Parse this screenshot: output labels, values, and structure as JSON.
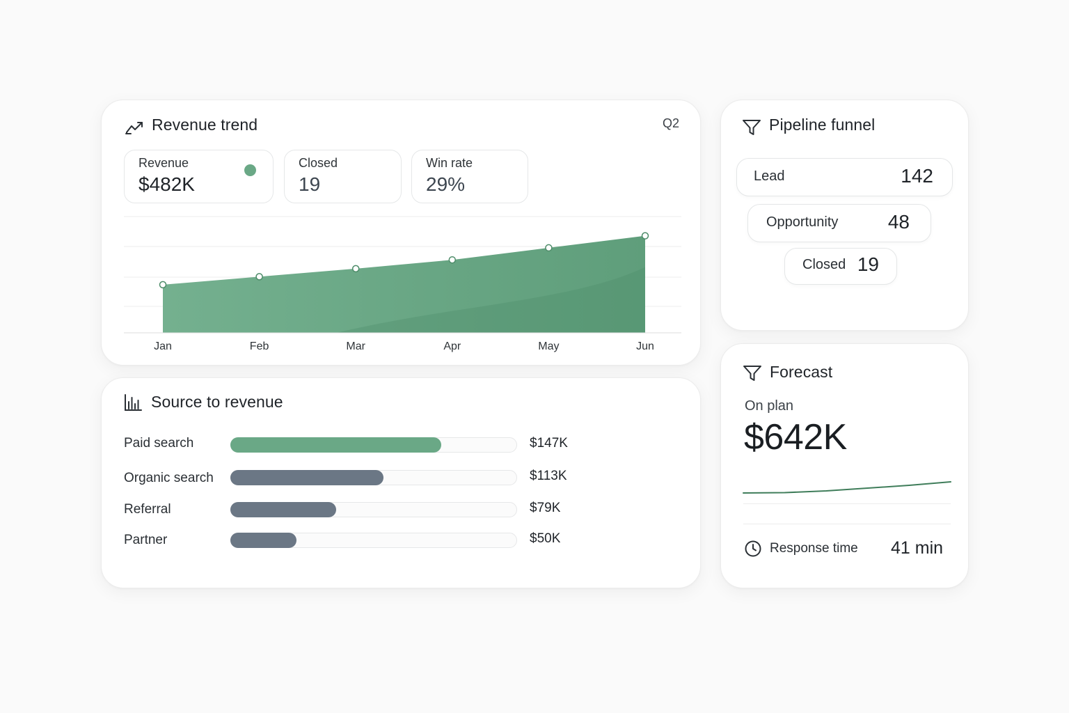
{
  "colors": {
    "accent_green": "#6aa886",
    "green_dark": "#4d8c69",
    "slate_bar": "#6b7785",
    "line_dark": "#3f7d5a"
  },
  "revenue_trend": {
    "title": "Revenue trend",
    "icon": "trend-line-icon",
    "period": "Q2",
    "kpis": [
      {
        "label": "Revenue",
        "value": "$482K"
      },
      {
        "label": "Closed",
        "value": "19"
      },
      {
        "label": "Win rate",
        "value": "29%"
      }
    ]
  },
  "chart_data": {
    "type": "area",
    "title": "",
    "xlabel": "",
    "ylabel": "",
    "categories": [
      "Jan",
      "Feb",
      "Mar",
      "Apr",
      "May",
      "Jun"
    ],
    "series": [
      {
        "values": [
          60,
          70,
          80,
          91,
          106,
          121
        ]
      }
    ],
    "ylim": [
      0,
      145
    ],
    "grid": true,
    "legend": "none"
  },
  "source_to_revenue": {
    "title": "Source to revenue",
    "icon": "bar-chart-icon",
    "max_value": 200,
    "rows": [
      {
        "label": "Paid search",
        "value": "$147K",
        "amount": 147,
        "color": "#6aa886"
      },
      {
        "label": "Organic search",
        "value": "$113K",
        "amount": 107,
        "color": "#6b7785"
      },
      {
        "label": "Referral",
        "value": "$79K",
        "amount": 74,
        "color": "#6b7785"
      },
      {
        "label": "Partner",
        "value": "$50K",
        "amount": 46,
        "color": "#6b7785"
      }
    ]
  },
  "pipeline_funnel": {
    "title": "Pipeline funnel",
    "icon": "funnel-icon",
    "stages": [
      {
        "label": "Lead",
        "value": "142"
      },
      {
        "label": "Opportunity",
        "value": "48"
      },
      {
        "label": "Closed",
        "value": "19"
      }
    ]
  },
  "forecast": {
    "title": "Forecast",
    "icon": "funnel-icon",
    "subtitle": "On plan",
    "value": "$642K",
    "trend_values": [
      0,
      0.5,
      3,
      7,
      11,
      16
    ],
    "response_label": "Response time",
    "response_icon": "clock-icon",
    "response_value": "41 min"
  }
}
